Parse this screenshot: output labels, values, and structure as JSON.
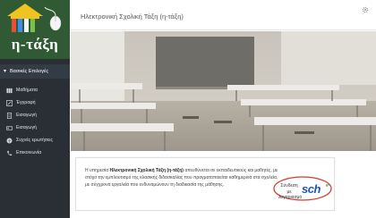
{
  "app": {
    "logo_text": "η-τάξη",
    "title": "Ηλεκτρονική Σχολική Τάξη (η-τάξη)"
  },
  "sidebar": {
    "section_label": "Βασικές Επιλογές",
    "items": [
      {
        "label": "Μαθήματα",
        "icon": "books-icon"
      },
      {
        "label": "Έγγραφή",
        "icon": "pencil-icon"
      },
      {
        "label": "Εισαγωγή",
        "icon": "document-icon"
      },
      {
        "label": "Εισαγωγή",
        "icon": "login-icon"
      },
      {
        "label": "Συχνές ερωτήσεις",
        "icon": "question-icon"
      },
      {
        "label": "Επικοινωνία",
        "icon": "phone-icon"
      }
    ]
  },
  "card": {
    "intro": "Η υπηρεσία ",
    "bold": "Ηλεκτρονική Σχολική Τάξη (η-τάξη)",
    "rest": " απευθύνεται σε εκπαιδευτικούς και μαθητές, με στόχο την εμπλουτισμό της κλασικής διδασκαλίας που πραγματοποιείται καθημερινά στα σχολεία, με σύγχρονα εργαλεία που ενδυναμώνουν τη διαδικασία της μάθησης."
  },
  "signin": {
    "label": "Σύνδεση με λογαριασμό",
    "brand": "sch",
    "brand_suffix": "gr"
  },
  "colors": {
    "sidebar_bg": "#2a2f36",
    "logo_bg": "#2f5a33",
    "accent_oval": "#d93a2f",
    "sch_blue": "#1a58b5"
  }
}
